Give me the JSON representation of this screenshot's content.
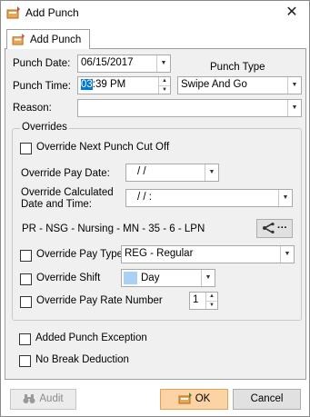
{
  "window": {
    "title": "Add Punch",
    "close": "✕"
  },
  "tab": {
    "label": "Add Punch"
  },
  "form": {
    "punch_date_label": "Punch Date:",
    "punch_date_value": "06/15/2017",
    "punch_type_label": "Punch Type",
    "punch_time_label": "Punch Time:",
    "punch_time_hour": "03",
    "punch_time_rest": ":39 PM",
    "punch_type_value": "Swipe And Go",
    "reason_label": "Reason:",
    "reason_value": ""
  },
  "overrides": {
    "title": "Overrides",
    "next_punch_label": "Override Next Punch Cut Off",
    "pay_date_label": "Override Pay Date:",
    "pay_date_value": "/    /",
    "calc_date_label_1": "Override Calculated",
    "calc_date_label_2": "Date and Time:",
    "calc_date_value": "/    /              :",
    "assignment_text": "PR - NSG - Nursing - MN - 35 - 6 - LPN",
    "assign_button_text": "···",
    "pay_type_label": "Override Pay Type",
    "pay_type_value": "REG - Regular",
    "shift_label": "Override Shift",
    "shift_value": "Day",
    "shift_color": "#a9d1f5",
    "rate_label": "Override Pay Rate Number",
    "rate_value": "1"
  },
  "exceptions": {
    "added_punch": "Added Punch Exception",
    "no_break": "No Break Deduction"
  },
  "buttons": {
    "audit": "Audit",
    "ok": "OK",
    "cancel": "Cancel",
    "ok_color": "#fcd3a4"
  }
}
